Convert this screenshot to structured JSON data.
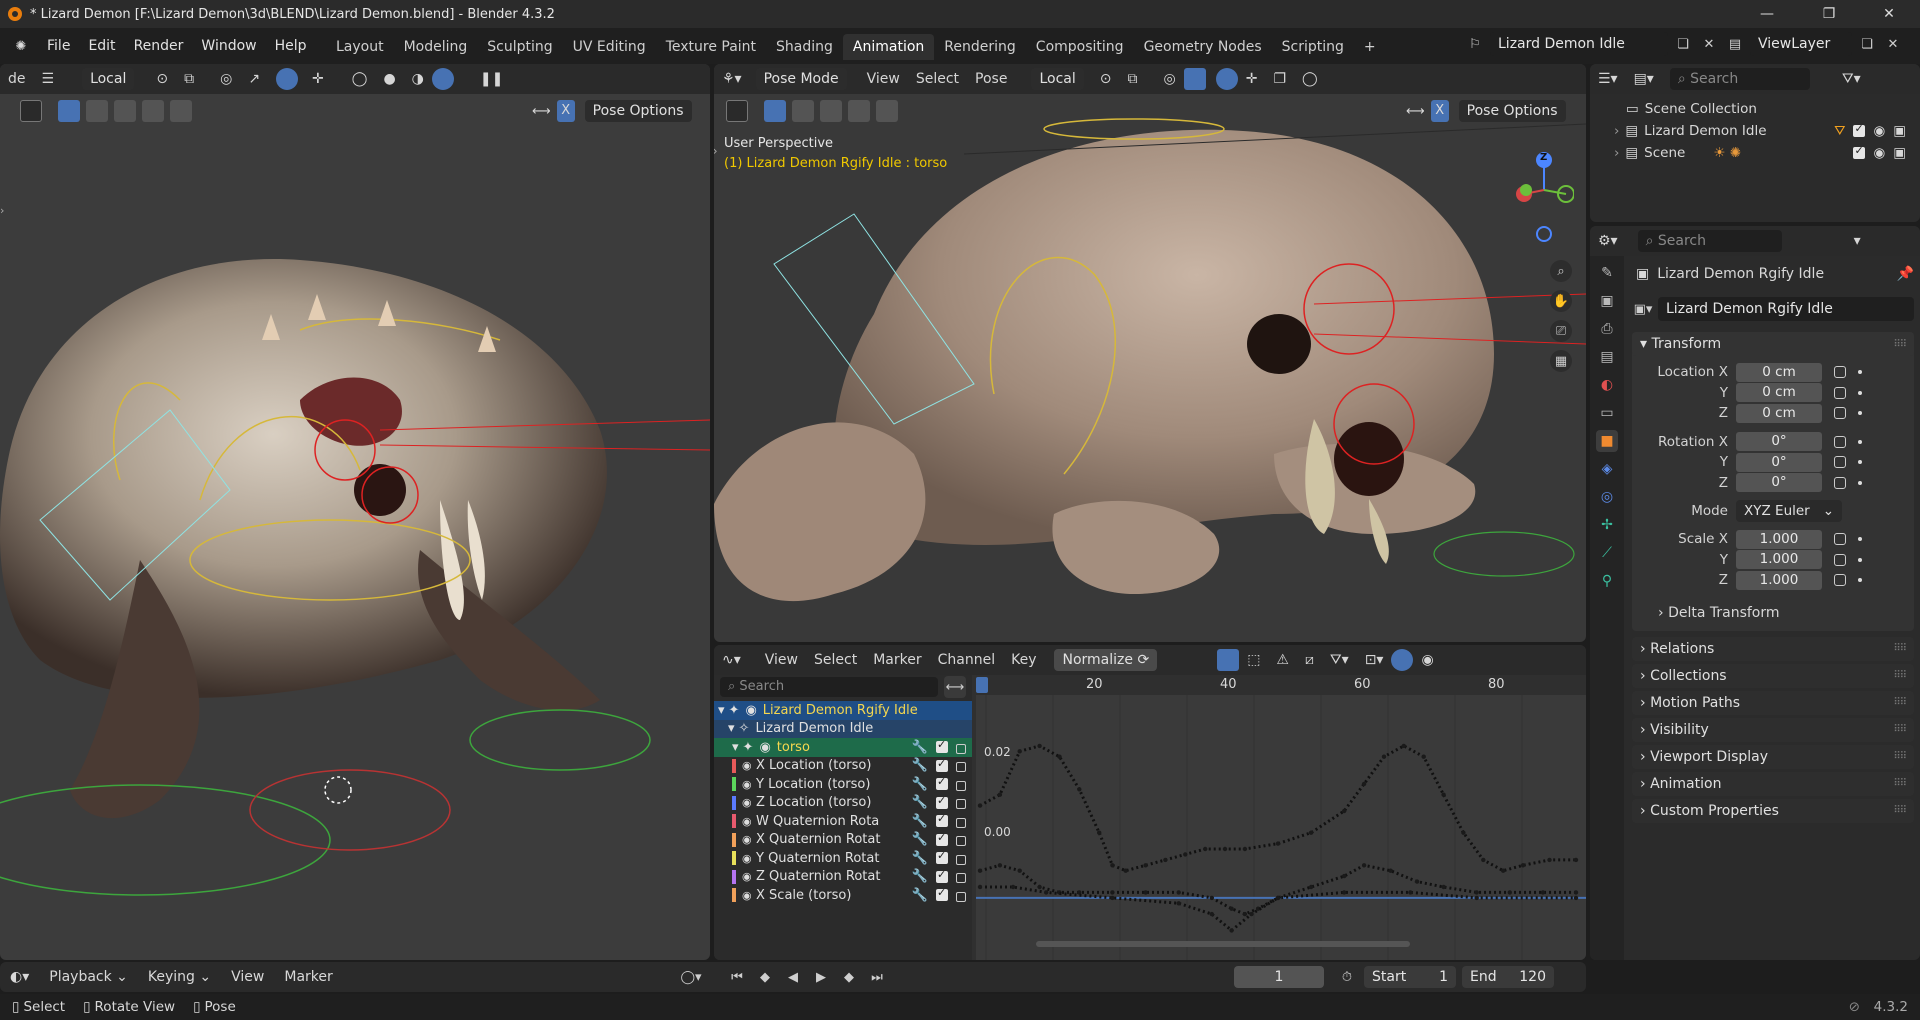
{
  "window": {
    "title": "* Lizard Demon [F:\\Lizard Demon\\3d\\BLEND\\Lizard Demon.blend] - Blender 4.3.2",
    "controls": [
      "minimize",
      "maximize",
      "close"
    ]
  },
  "menu": [
    "File",
    "Edit",
    "Render",
    "Window",
    "Help"
  ],
  "workspaces": [
    "Layout",
    "Modeling",
    "Sculpting",
    "UV Editing",
    "Texture Paint",
    "Shading",
    "Animation",
    "Rendering",
    "Compositing",
    "Geometry Nodes",
    "Scripting"
  ],
  "active_workspace": "Animation",
  "scene_selector": "Lizard Demon Idle",
  "view_layer": "ViewLayer",
  "left_viewport": {
    "mode_fragment": "de",
    "orientation": "Local",
    "pose_options": "Pose Options",
    "axis_x": "X"
  },
  "main_viewport": {
    "mode": "Pose Mode",
    "menus": [
      "View",
      "Select",
      "Pose"
    ],
    "orientation": "Local",
    "pose_options": "Pose Options",
    "axis_x": "X",
    "overlay_title": "User Perspective",
    "overlay_object": "(1) Lizard Demon Rgify Idle : torso",
    "gizmo_axis": "Z"
  },
  "graph_editor": {
    "menus": [
      "View",
      "Select",
      "Marker",
      "Channel",
      "Key"
    ],
    "normalize": "Normalize",
    "search_placeholder": "Search",
    "ruler": [
      "20",
      "40",
      "60",
      "80"
    ],
    "y_labels": [
      "0.02",
      "0.00"
    ],
    "rig": "Lizard Demon Rgify Idle",
    "action": "Lizard Demon Idle",
    "group": "torso",
    "channels": [
      {
        "name": "X Location (torso)",
        "color": "#e85a5a"
      },
      {
        "name": "Y Location (torso)",
        "color": "#5cd65c"
      },
      {
        "name": "Z Location (torso)",
        "color": "#5b7bff"
      },
      {
        "name": "W Quaternion Rota",
        "color": "#e85a6e"
      },
      {
        "name": "X Quaternion Rotat",
        "color": "#f2a15a"
      },
      {
        "name": "Y Quaternion Rotat",
        "color": "#e8e05a"
      },
      {
        "name": "Z Quaternion Rotat",
        "color": "#b574f0"
      },
      {
        "name": "X Scale (torso)",
        "color": "#f0a05a"
      }
    ]
  },
  "outliner": {
    "search_placeholder": "Search",
    "root": "Scene Collection",
    "items": [
      "Lizard Demon Idle",
      "Scene"
    ]
  },
  "properties": {
    "search_placeholder": "Search",
    "object_name": "Lizard Demon Rgify Idle",
    "data_name": "Lizard Demon Rgify Idle",
    "transform_title": "Transform",
    "location": {
      "label": "Location X",
      "x": "0 cm",
      "y": "0 cm",
      "z": "0 cm"
    },
    "rotation": {
      "label": "Rotation X",
      "x": "0°",
      "y": "0°",
      "z": "0°"
    },
    "mode_label": "Mode",
    "mode": "XYZ Euler",
    "scale": {
      "label": "Scale X",
      "x": "1.000",
      "y": "1.000",
      "z": "1.000"
    },
    "axis_y": "Y",
    "axis_z": "Z",
    "delta": "Delta Transform",
    "panels": [
      "Relations",
      "Collections",
      "Motion Paths",
      "Visibility",
      "Viewport Display",
      "Animation",
      "Custom Properties"
    ]
  },
  "timeline": {
    "menus": [
      "Playback",
      "Keying",
      "View",
      "Marker"
    ],
    "current_frame": "1",
    "start_label": "Start",
    "start": "1",
    "end_label": "End",
    "end": "120"
  },
  "statusbar": {
    "items": [
      "Select",
      "Rotate View",
      "Pose"
    ],
    "version": "4.3.2"
  },
  "colors": {
    "accent_blue": "#4772b3",
    "keyframe_yellow": "#f0c800",
    "rig_highlight": "#1f4e86",
    "torso_green": "#1e6b4a"
  },
  "curve_data": {
    "frame_range": [
      0,
      90
    ],
    "value_range": [
      -0.005,
      0.03
    ],
    "upper": [
      [
        0,
        0.017
      ],
      [
        3,
        0.019
      ],
      [
        6,
        0.027
      ],
      [
        9,
        0.028
      ],
      [
        12,
        0.026
      ],
      [
        15,
        0.02
      ],
      [
        18,
        0.012
      ],
      [
        20,
        0.006
      ],
      [
        22,
        0.005
      ],
      [
        25,
        0.006
      ],
      [
        28,
        0.007
      ],
      [
        31,
        0.008
      ],
      [
        34,
        0.009
      ],
      [
        37,
        0.009
      ],
      [
        40,
        0.009
      ],
      [
        45,
        0.01
      ],
      [
        50,
        0.012
      ],
      [
        55,
        0.016
      ],
      [
        58,
        0.021
      ],
      [
        61,
        0.026
      ],
      [
        64,
        0.028
      ],
      [
        67,
        0.026
      ],
      [
        70,
        0.019
      ],
      [
        73,
        0.012
      ],
      [
        76,
        0.007
      ],
      [
        79,
        0.005
      ],
      [
        82,
        0.006
      ],
      [
        86,
        0.007
      ],
      [
        90,
        0.007
      ]
    ],
    "lower": [
      [
        0,
        0.005
      ],
      [
        3,
        0.006
      ],
      [
        6,
        0.005
      ],
      [
        9,
        0.002
      ],
      [
        12,
        0.001
      ],
      [
        15,
        0.001
      ],
      [
        20,
        0.001
      ],
      [
        25,
        0.001
      ],
      [
        30,
        0.001
      ],
      [
        35,
        0.0
      ],
      [
        38,
        -0.002
      ],
      [
        40,
        -0.003
      ],
      [
        42,
        -0.002
      ],
      [
        45,
        0.0
      ],
      [
        50,
        0.002
      ],
      [
        55,
        0.004
      ],
      [
        58,
        0.006
      ],
      [
        62,
        0.005
      ],
      [
        66,
        0.003
      ],
      [
        70,
        0.002
      ],
      [
        75,
        0.001
      ],
      [
        80,
        0.001
      ],
      [
        85,
        0.001
      ],
      [
        90,
        0.001
      ]
    ],
    "lower2": [
      [
        0,
        0.002
      ],
      [
        5,
        0.002
      ],
      [
        10,
        0.001
      ],
      [
        20,
        0.0
      ],
      [
        30,
        -0.001
      ],
      [
        35,
        -0.003
      ],
      [
        38,
        -0.006
      ],
      [
        41,
        -0.003
      ],
      [
        45,
        0.0
      ],
      [
        55,
        0.001
      ],
      [
        65,
        0.001
      ],
      [
        75,
        0.0
      ],
      [
        90,
        0.0
      ]
    ]
  }
}
